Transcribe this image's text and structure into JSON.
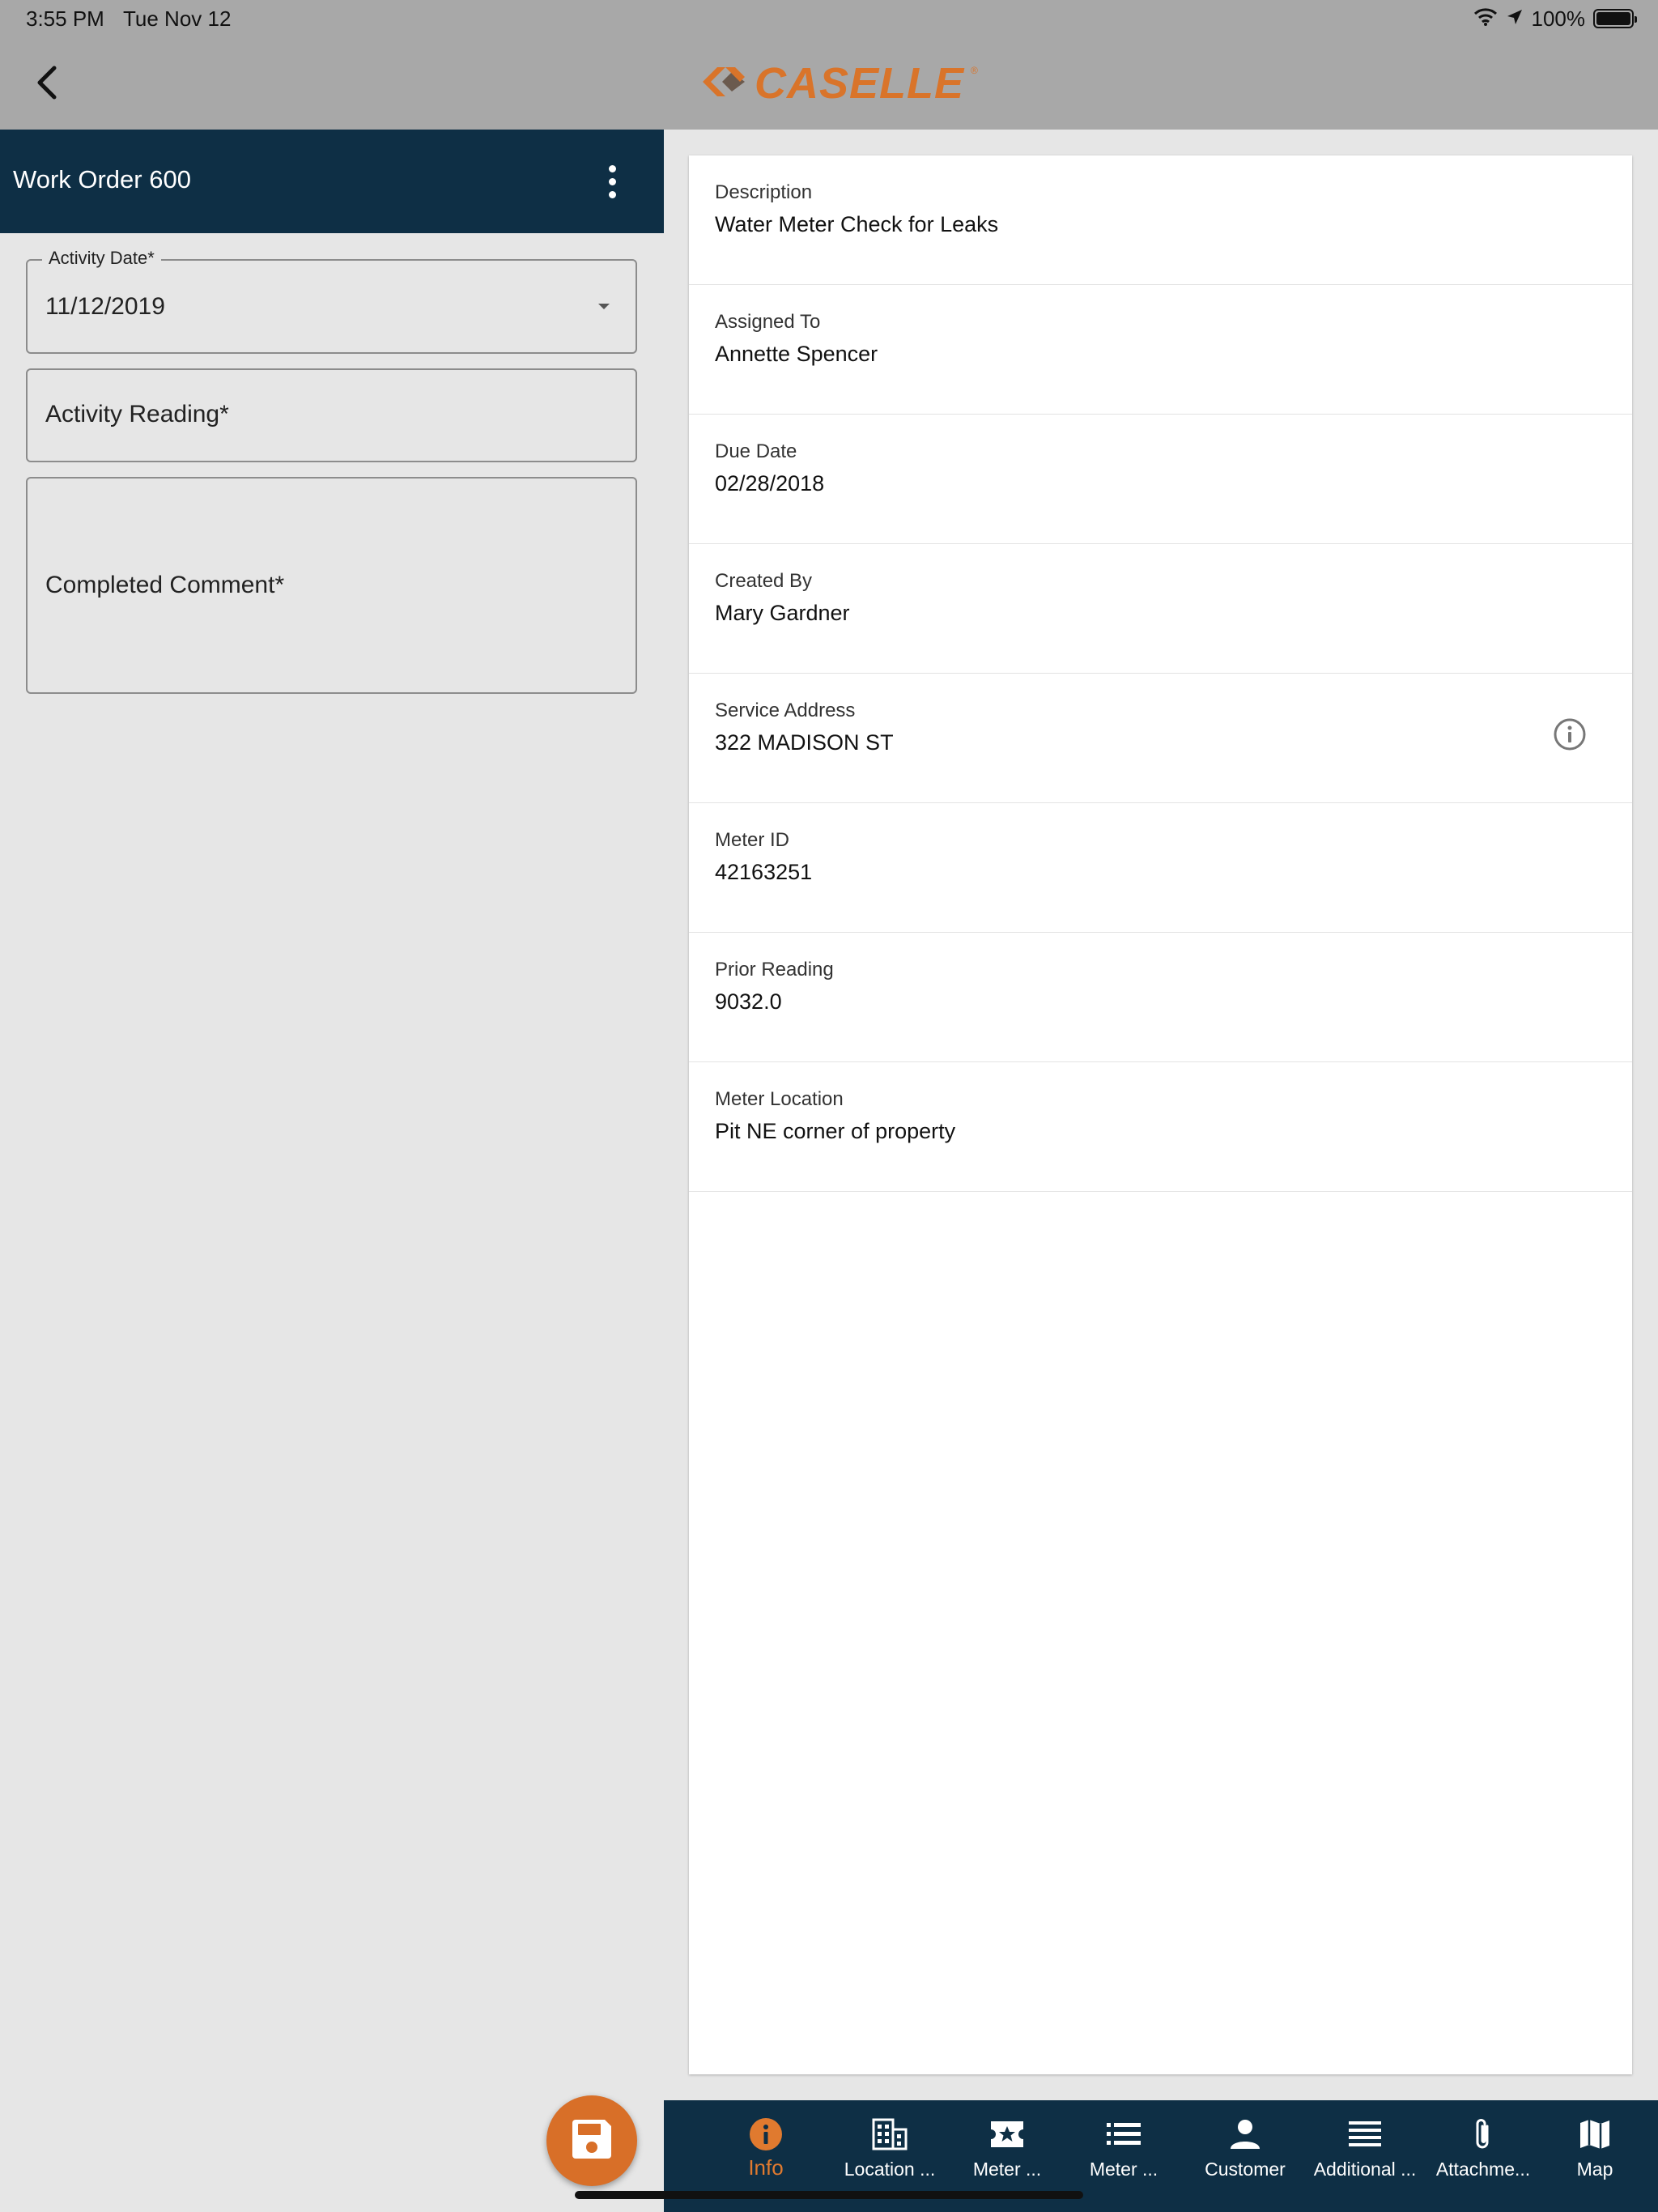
{
  "status_bar": {
    "time": "3:55 PM",
    "date": "Tue Nov 12",
    "battery_text": "100%",
    "battery_level": 1.0
  },
  "header": {
    "brand": "CASELLE",
    "brand_mark": "®",
    "back_icon": "chevron-left-icon",
    "brand_color": "#d9742a"
  },
  "left_panel": {
    "title": "Work Order 600",
    "menu_icon": "more-vertical-icon",
    "form": {
      "activity_date": {
        "label": "Activity Date*",
        "value": "11/12/2019"
      },
      "activity_reading": {
        "placeholder": "Activity Reading*"
      },
      "completed_comment": {
        "placeholder": "Completed Comment*"
      }
    }
  },
  "details": [
    {
      "label": "Description",
      "value": "Water Meter Check for Leaks"
    },
    {
      "label": "Assigned To",
      "value": "Annette Spencer"
    },
    {
      "label": "Due Date",
      "value": "02/28/2018"
    },
    {
      "label": "Created By",
      "value": "Mary Gardner"
    },
    {
      "label": "Service Address",
      "value": "322 MADISON ST",
      "icon": "info-icon"
    },
    {
      "label": "Meter ID",
      "value": "42163251"
    },
    {
      "label": "Prior Reading",
      "value": "9032.0"
    },
    {
      "label": "Meter Location",
      "value": "Pit NE corner of property"
    }
  ],
  "bottom_nav": [
    {
      "label": "Info",
      "icon": "info-icon",
      "active": true
    },
    {
      "label": "Location ...",
      "icon": "building-icon"
    },
    {
      "label": "Meter ...",
      "icon": "ticket-star-icon"
    },
    {
      "label": "Meter ...",
      "icon": "list-icon"
    },
    {
      "label": "Customer",
      "icon": "person-icon"
    },
    {
      "label": "Additional ...",
      "icon": "lines-icon"
    },
    {
      "label": "Attachme...",
      "icon": "paperclip-icon"
    },
    {
      "label": "Map",
      "icon": "map-icon"
    }
  ],
  "fab": {
    "icon": "save-icon"
  },
  "colors": {
    "header_grey": "#a8a8a8",
    "navy": "#0e2f45",
    "accent_orange": "#d86f28"
  }
}
